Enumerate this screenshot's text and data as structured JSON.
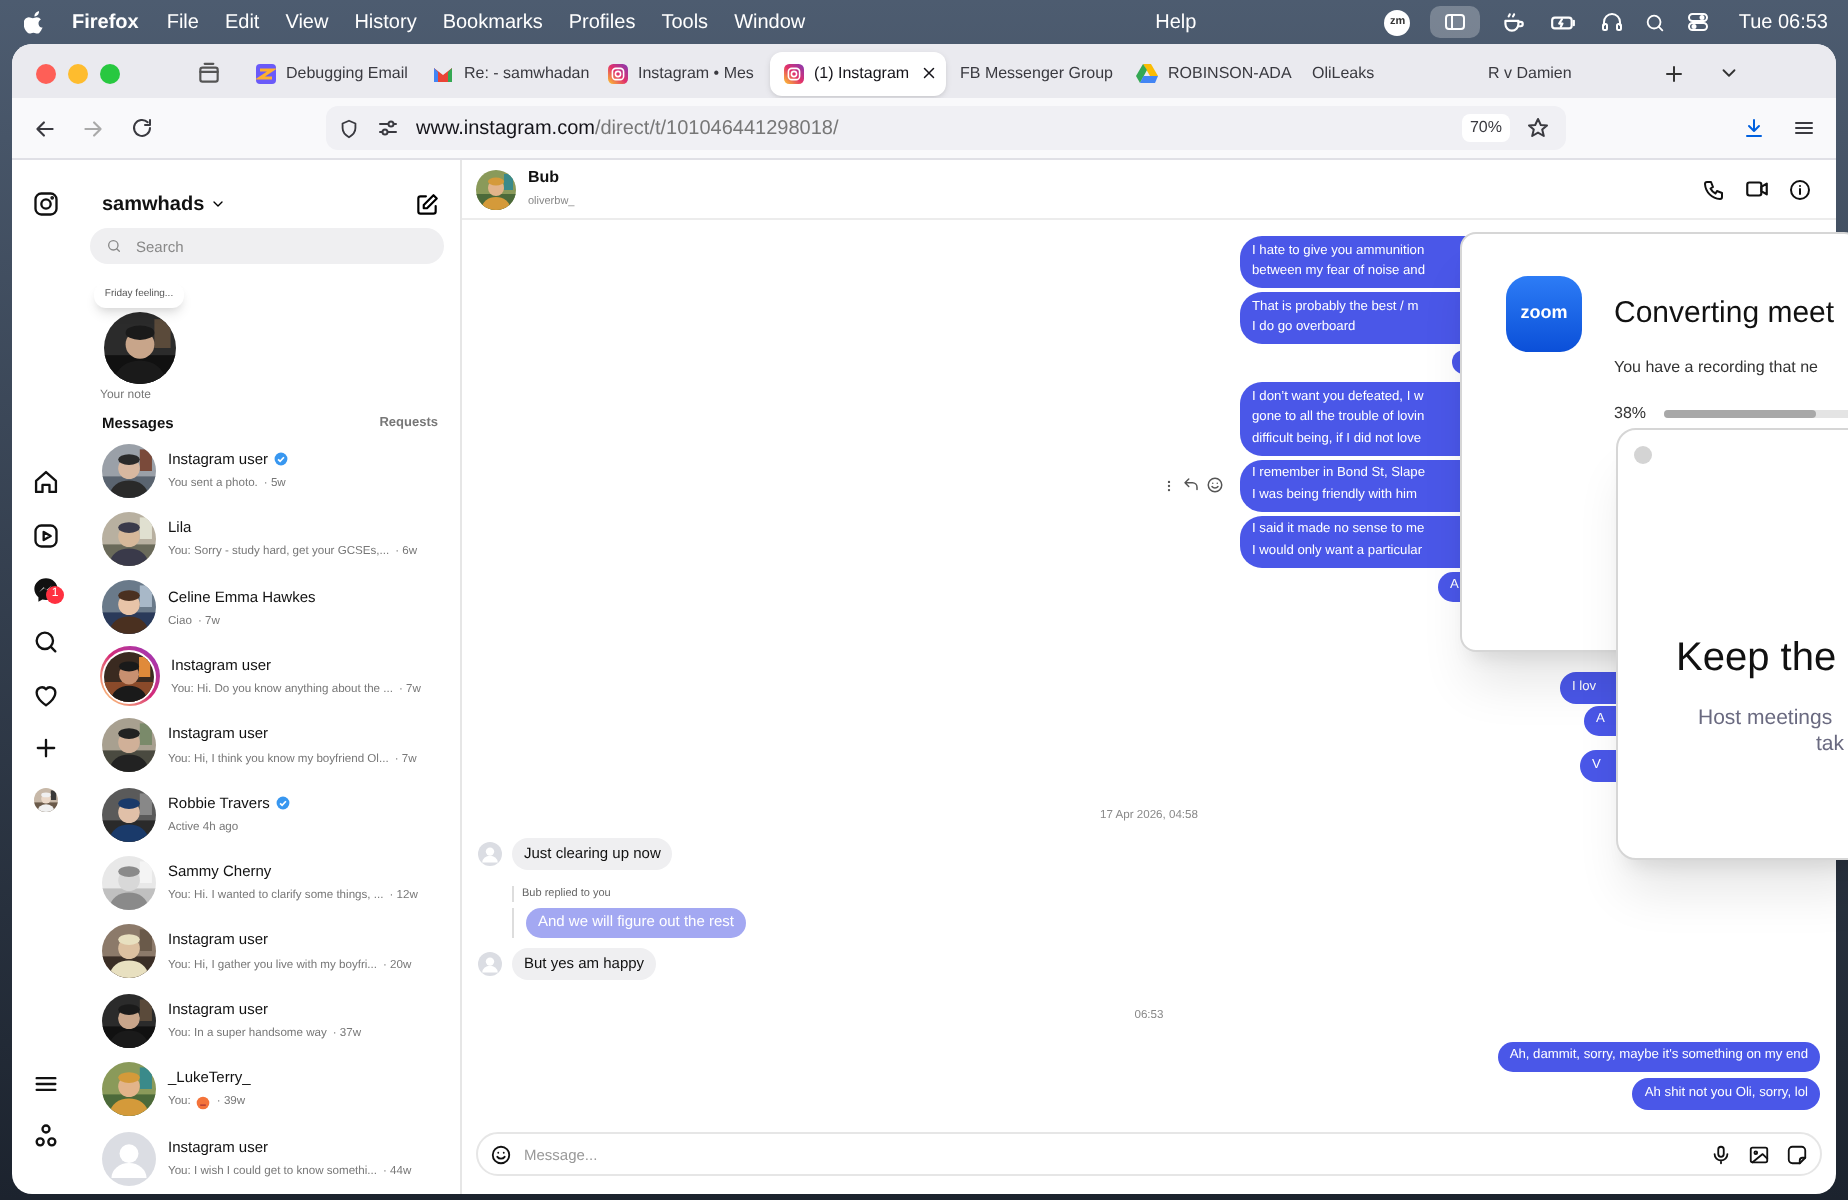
{
  "menubar": {
    "app": "Firefox",
    "menus": [
      "File",
      "Edit",
      "View",
      "History",
      "Bookmarks",
      "Profiles",
      "Tools",
      "Window"
    ],
    "help": "Help",
    "status_badge": "zm",
    "clock": "Tue 06:53"
  },
  "tabs": [
    {
      "title": "Debugging Email",
      "selected": false
    },
    {
      "title": "Re: - samwhadan",
      "selected": false
    },
    {
      "title": "Instagram • Mes",
      "selected": false
    },
    {
      "title": "(1) Instagram",
      "selected": true
    },
    {
      "title": "FB Messenger Group",
      "selected": false
    },
    {
      "title": "ROBINSON-ADA",
      "selected": false
    },
    {
      "title": "OliLeaks",
      "selected": false
    },
    {
      "title": "R v Damien",
      "selected": false
    }
  ],
  "address_bar": {
    "host": "www.instagram.com",
    "path": "/direct/t/101046441298018/",
    "zoom": "70%"
  },
  "nav_rail": {
    "messages_badge": "1"
  },
  "inbox": {
    "account": "samwhads",
    "search_placeholder": "Search",
    "note": "Friday feeling...",
    "note_label": "Your note",
    "heading": "Messages",
    "requests": "Requests",
    "conversations": [
      {
        "name": "Instagram user",
        "verified": true,
        "story": false,
        "preview": "You sent a photo.",
        "time": "· 5w"
      },
      {
        "name": "Lila",
        "verified": false,
        "story": false,
        "preview": "You: Sorry - study hard, get your GCSEs,...",
        "time": "· 6w"
      },
      {
        "name": "Celine Emma Hawkes",
        "verified": false,
        "story": false,
        "preview": "Ciao",
        "time": "· 7w"
      },
      {
        "name": "Instagram user",
        "verified": false,
        "story": true,
        "preview": "You: Hi. Do you know anything about the ...",
        "time": "· 7w"
      },
      {
        "name": "Instagram user",
        "verified": false,
        "story": false,
        "preview": "You: Hi, I think you know my boyfriend Ol...",
        "time": "· 7w"
      },
      {
        "name": "Robbie Travers",
        "verified": true,
        "story": false,
        "preview": "Active 4h ago"
      },
      {
        "name": "Sammy Cherny",
        "verified": false,
        "story": false,
        "preview": "You: Hi. I wanted to clarify some things, ...",
        "time": "· 12w"
      },
      {
        "name": "Instagram user",
        "verified": false,
        "story": false,
        "preview": "You: Hi, I gather you live with my boyfri...",
        "time": "· 20w"
      },
      {
        "name": "Instagram user",
        "verified": false,
        "story": false,
        "preview": "You: In a super handsome way",
        "time": "· 37w"
      },
      {
        "name": "_LukeTerry_",
        "verified": false,
        "story": false,
        "preview": "You:",
        "emoji": true,
        "time": "· 39w"
      },
      {
        "name": "Instagram user",
        "verified": false,
        "story": false,
        "preview": "You: I wish I could get to know somethi...",
        "time": "· 44w"
      }
    ]
  },
  "chat": {
    "name": "Bub",
    "username": "oliverbw_",
    "composer_placeholder": "Message...",
    "messages": [
      {
        "kind": "out",
        "lines": [
          "I hate to give you ammunition",
          "between my fear of noise and"
        ]
      },
      {
        "kind": "out",
        "lines": [
          "That is probably the best / m",
          "I do go overboard"
        ]
      },
      {
        "kind": "out_hidden"
      },
      {
        "kind": "out",
        "lines": [
          "I don’t want you defeated, I w",
          "gone to all the trouble of lovin",
          "difficult being, if I did not love"
        ]
      },
      {
        "kind": "out",
        "lines": [
          "I remember in Bond St, Slape",
          "I was being friendly with him"
        ],
        "actions": true
      },
      {
        "kind": "out",
        "lines": [
          "I said it made no sense to me",
          "I would only want a particular"
        ]
      },
      {
        "kind": "out",
        "lines": [
          "A"
        ]
      },
      {
        "kind": "out",
        "lines": [
          "I lov"
        ]
      },
      {
        "kind": "out",
        "lines": [
          "A"
        ]
      },
      {
        "kind": "out",
        "lines": [
          "V"
        ]
      },
      {
        "kind": "time",
        "text": "17 Apr 2026, 04:58"
      },
      {
        "kind": "in",
        "text": "Just clearing up now"
      },
      {
        "kind": "reply_label",
        "text": "Bub replied to you"
      },
      {
        "kind": "reply",
        "text": "And we will figure out the rest"
      },
      {
        "kind": "in",
        "text": "But yes am happy"
      },
      {
        "kind": "time",
        "text": "06:53"
      },
      {
        "kind": "out",
        "lines": [
          "Ah, dammit, sorry, maybe it's something on my end"
        ]
      },
      {
        "kind": "out",
        "lines": [
          "Ah shit not you Oli, sorry, lol"
        ]
      }
    ]
  },
  "zoom_window": {
    "logo": "zoom",
    "title": "Converting meet",
    "subtitle": "You have a recording that ne",
    "percent": "38%",
    "progress": {
      "level": 0.38
    }
  },
  "dialog": {
    "heading": "Keep the",
    "lines": [
      "Host meetings",
      "tak"
    ]
  }
}
